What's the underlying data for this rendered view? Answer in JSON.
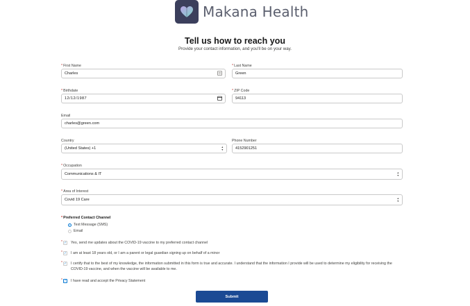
{
  "brand": {
    "name": "Makana Health",
    "logo_color": "#3b3f5c"
  },
  "header": {
    "title": "Tell us how to reach you",
    "subtitle": "Provide your contact information, and you'll be on your way."
  },
  "form": {
    "first_name": {
      "label": "First Name",
      "value": "Charles",
      "required": "*"
    },
    "last_name": {
      "label": "Last Name",
      "value": "Green",
      "required": "*"
    },
    "birthdate": {
      "label": "Birthdate",
      "value": "12/12/1987",
      "required": "*"
    },
    "zip": {
      "label": "ZIP Code",
      "value": "94113",
      "required": "*"
    },
    "email": {
      "label": "Email",
      "value": "charles@green.com"
    },
    "country": {
      "label": "Country",
      "value": "(United States) +1"
    },
    "phone": {
      "label": "Phone Number",
      "value": "4152901251"
    },
    "occupation": {
      "label": "Occupation",
      "value": "Communications & IT",
      "required": "*"
    },
    "interest": {
      "label": "Area of Interest",
      "value": "Covid 19 Care",
      "required": "*"
    }
  },
  "contact_channel": {
    "label": "Preferred Contact Channel",
    "required": "*",
    "options": [
      {
        "label": "Text Message (SMS)",
        "selected": true
      },
      {
        "label": "Email",
        "selected": false
      }
    ]
  },
  "consents": [
    {
      "text": "Yes, send me updates about the COVID-19 vaccine to my preferred contact channel",
      "checked": true
    },
    {
      "text": "I am at least 18 years old, or I am a parent or legal guardian signing up on behalf of a minor",
      "checked": true
    },
    {
      "text": "I certify that to the best of my knowledge, the information submitted in this form is true and accurate. I understand that the information I provide will be used to determine my eligibility for receiving the COVID-19 vaccine, and when the vaccine will be available to me.",
      "checked": true
    },
    {
      "text": "I have read and accept the Privacy Statement",
      "checked": true
    }
  ],
  "submit_label": "Submit",
  "colors": {
    "primary": "#1b4a94",
    "accent": "#0176d3",
    "required": "#c23934"
  }
}
